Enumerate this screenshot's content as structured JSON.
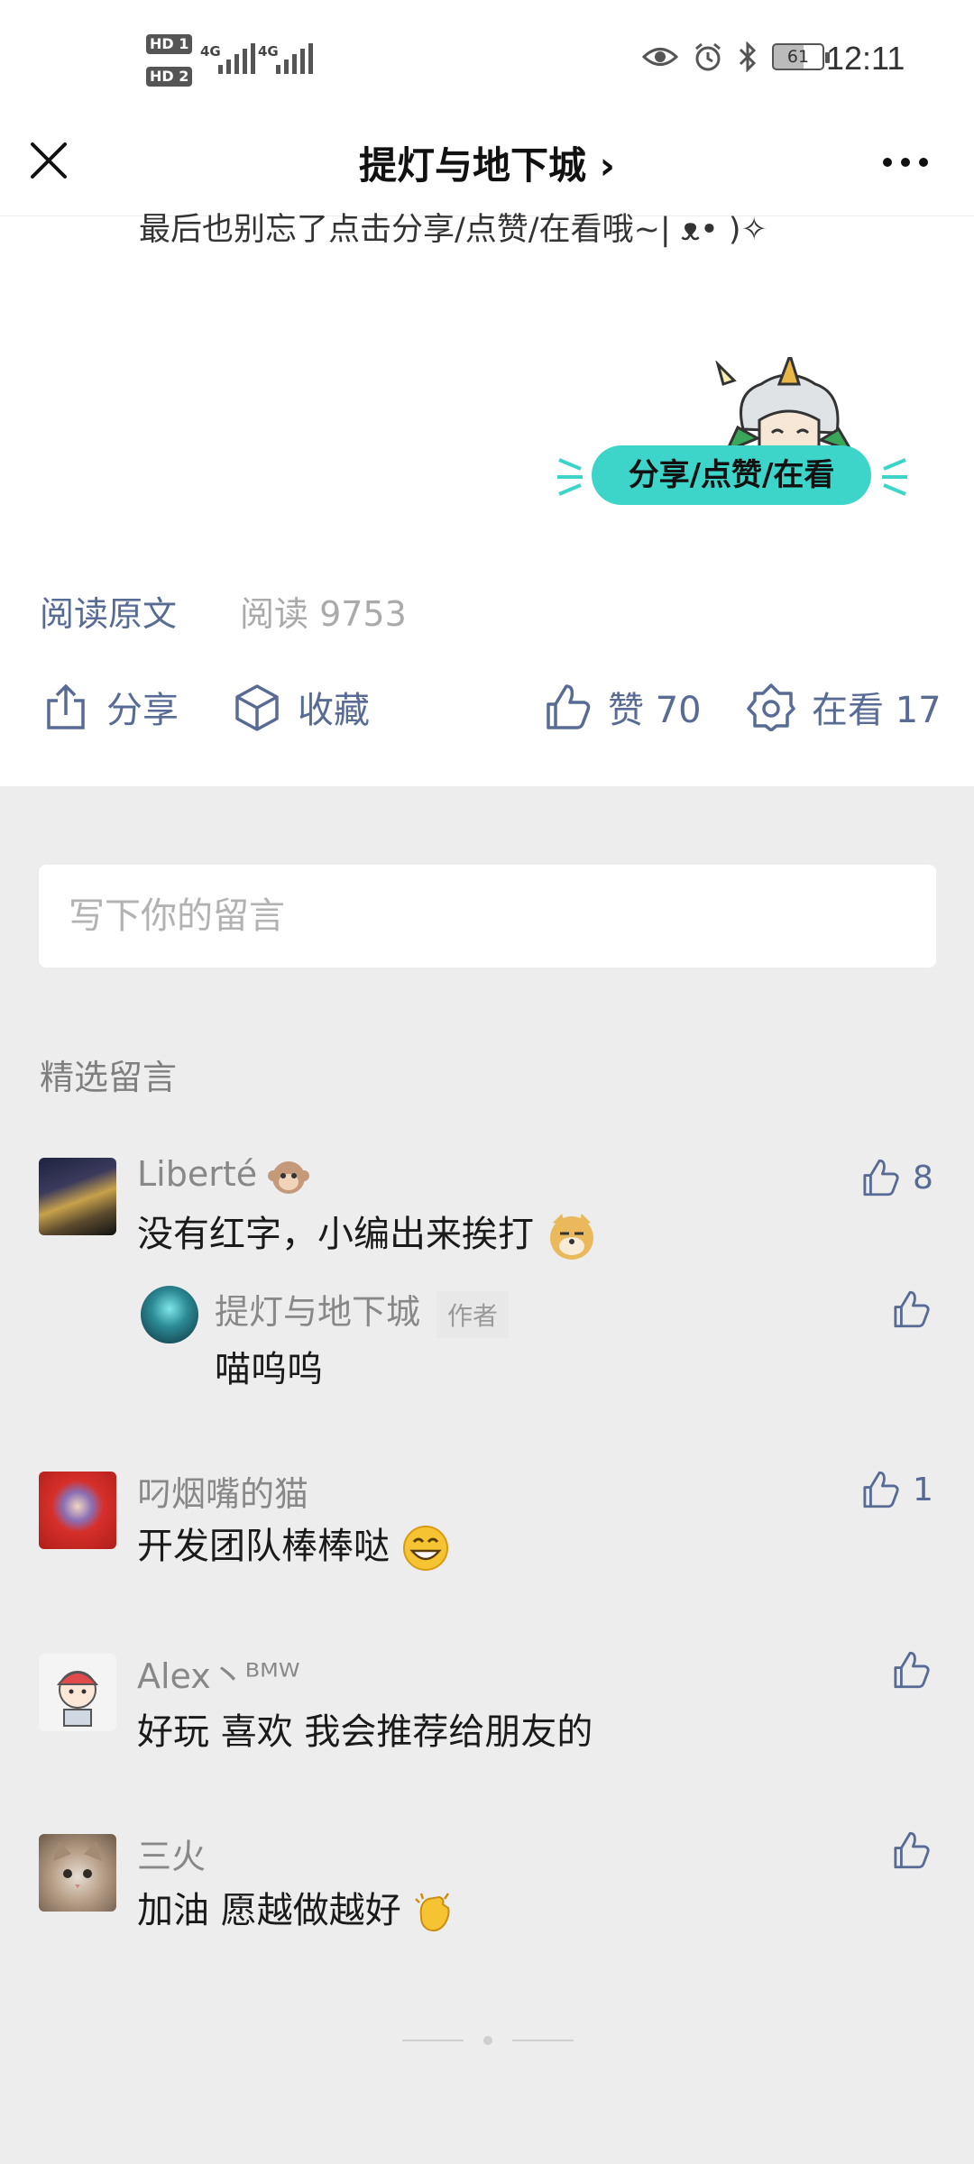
{
  "status_bar": {
    "hd1": "HD",
    "hd1_sub": "1",
    "hd2": "HD",
    "hd2_sub": "2",
    "net1": "4G",
    "net2": "4G",
    "battery": "61",
    "time": "12:11"
  },
  "nav": {
    "title": "提灯与地下城 ›"
  },
  "article": {
    "tip": "最后也别忘了点击分享/点赞/在看哦~| ᴥ• )✧",
    "sticker_text": "分享/点赞/在看",
    "read_original": "阅读原文",
    "read_count": "阅读 9753"
  },
  "actions": {
    "share": "分享",
    "favorite": "收藏",
    "like": "赞 70",
    "watching": "在看 17"
  },
  "comment_input": {
    "placeholder": "写下你的留言"
  },
  "comments_section": {
    "title": "精选留言"
  },
  "comments": [
    {
      "name": "Liberté",
      "text": "没有红字，小编出来挨打",
      "likes": "8"
    },
    {
      "name": "叼烟嘴的猫",
      "text": "开发团队棒棒哒",
      "likes": "1"
    },
    {
      "name": "Alex丶ᴮᴹᵂ",
      "text": "好玩 喜欢 我会推荐给朋友的",
      "likes": ""
    },
    {
      "name": "三火",
      "text": "加油 愿越做越好",
      "likes": ""
    }
  ],
  "reply": {
    "name": "提灯与地下城",
    "badge": "作者",
    "text": "喵呜呜"
  },
  "colors": {
    "link": "#576b95",
    "accent": "#3dd4c9",
    "background": "#ededed"
  }
}
